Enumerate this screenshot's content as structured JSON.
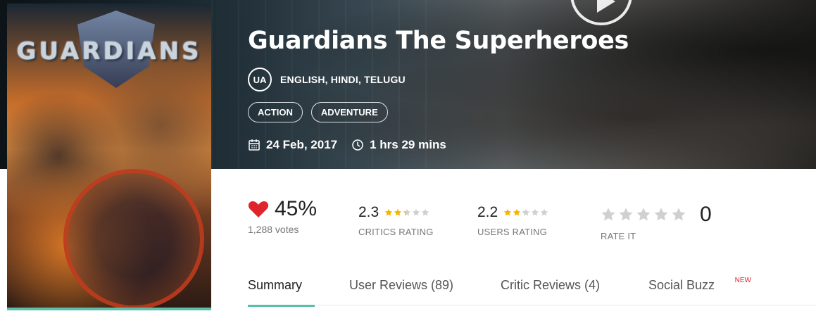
{
  "movie": {
    "title": "Guardians The Superheroes",
    "certificate": "UA",
    "languages": "ENGLISH, HINDI, TELUGU",
    "genres": [
      "ACTION",
      "ADVENTURE"
    ],
    "release_date": "24 Feb, 2017",
    "duration": "1 hrs 29 mins",
    "poster_logo": "GUARDIANS"
  },
  "ratings": {
    "likes_percent": "45%",
    "votes": "1,288 votes",
    "critics": {
      "score": "2.3",
      "stars": 2.3,
      "label": "CRITICS RATING"
    },
    "users": {
      "score": "2.2",
      "stars": 2.2,
      "label": "USERS RATING"
    },
    "rate_it": {
      "label": "RATE IT",
      "value": "0"
    }
  },
  "tabs": [
    {
      "label": "Summary",
      "active": true
    },
    {
      "label": "User Reviews (89)"
    },
    {
      "label": "Critic Reviews (4)"
    },
    {
      "label": "Social Buzz",
      "badge": "NEW"
    }
  ],
  "colors": {
    "accent": "#5cc0a8",
    "heart": "#e0242b",
    "star_filled": "#f5b400",
    "star_empty": "#d0d0d0",
    "new_badge": "#e0242b"
  }
}
